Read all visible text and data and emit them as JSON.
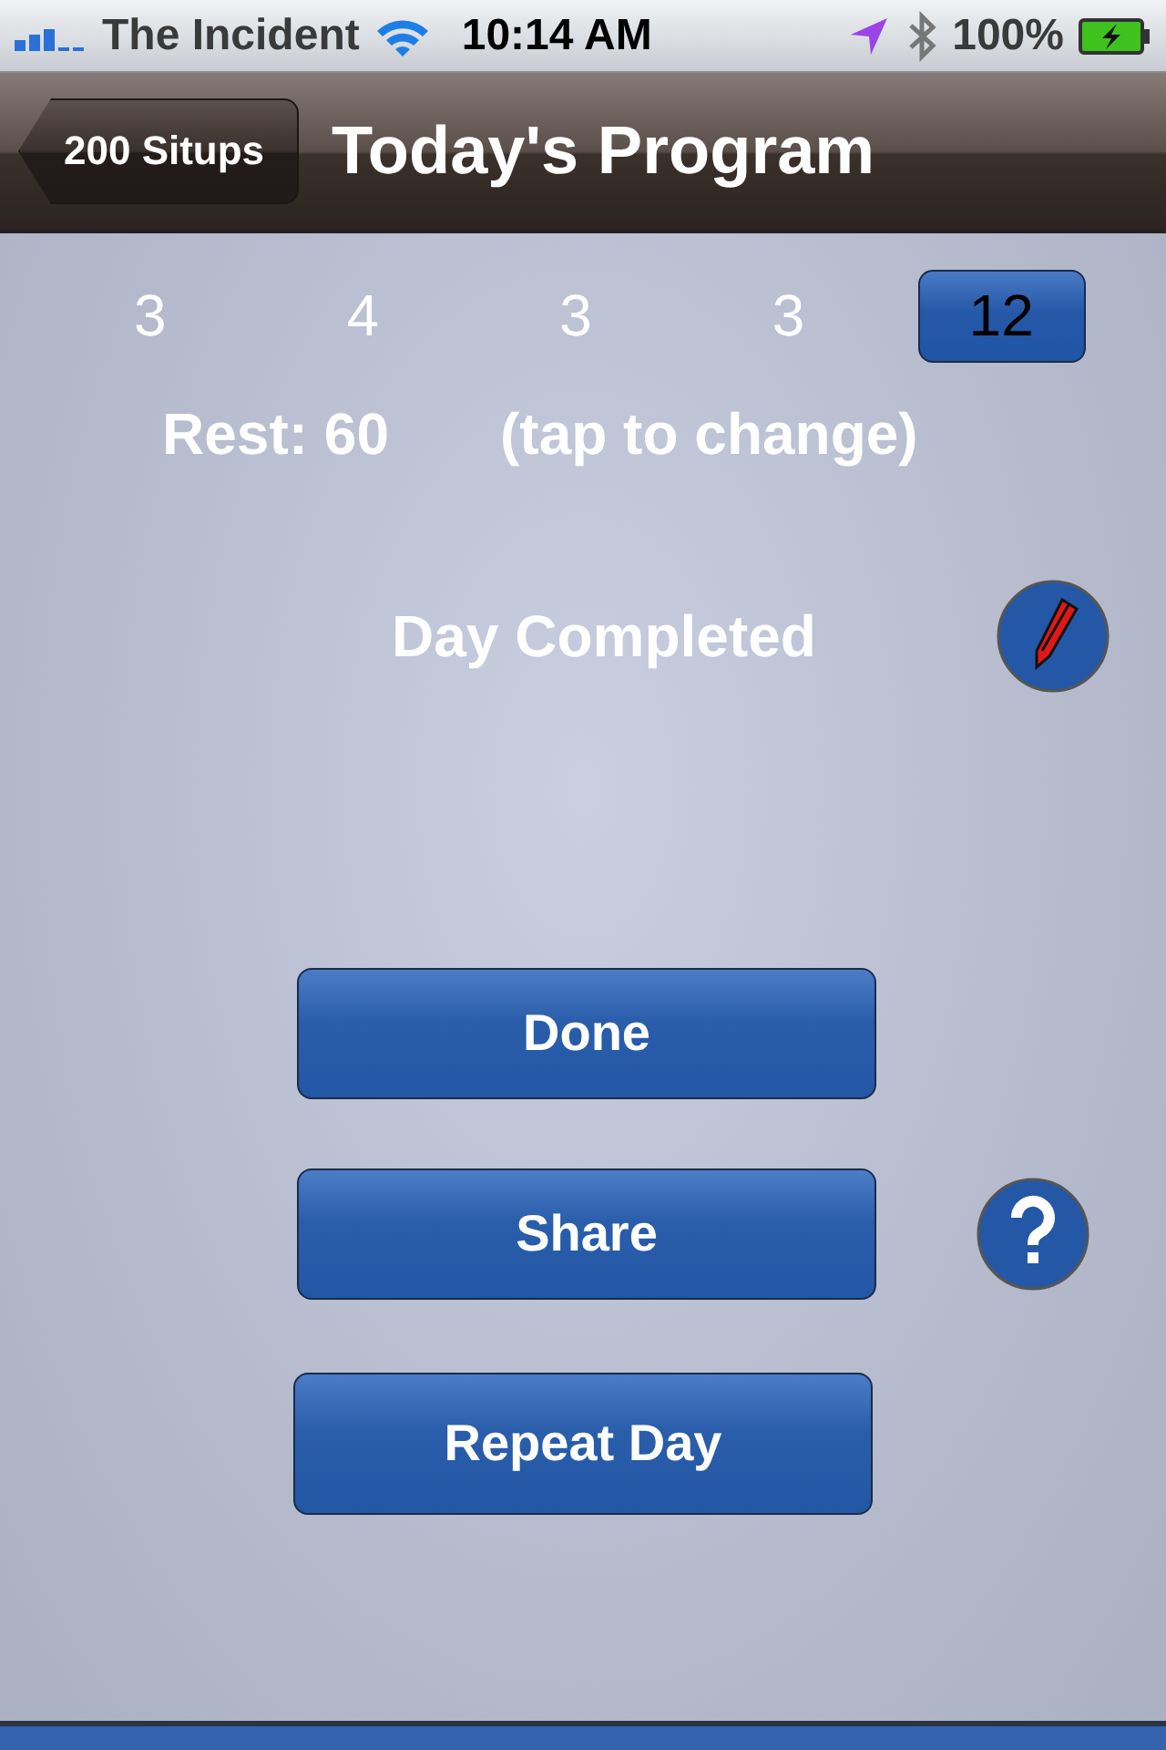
{
  "status_bar": {
    "carrier": "The Incident",
    "time": "10:14 AM",
    "battery": "100%"
  },
  "nav_bar": {
    "back_button": "200 Situps",
    "title": "Today's Program"
  },
  "sets": [
    {
      "label": "3",
      "selected": false
    },
    {
      "label": "4",
      "selected": false
    },
    {
      "label": "3",
      "selected": false
    },
    {
      "label": "3",
      "selected": false
    },
    {
      "label": "12",
      "selected": true
    }
  ],
  "rest": {
    "label": "Rest: 60",
    "hint": "(tap to change)"
  },
  "status_message": "Day Completed",
  "buttons": [
    {
      "label": "Done"
    },
    {
      "label": "Share"
    },
    {
      "label": "Repeat Day"
    }
  ]
}
